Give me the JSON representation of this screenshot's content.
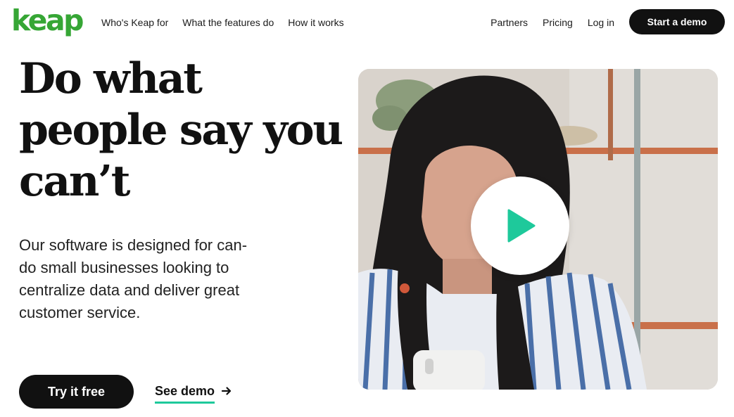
{
  "brand": {
    "logo_text": "keap",
    "accent_color": "#36a635",
    "cta_underline_color": "#1ec99b",
    "play_color": "#1ec99b"
  },
  "nav": {
    "left": [
      "Who's Keap for",
      "What the features do",
      "How it works"
    ],
    "right": [
      "Partners",
      "Pricing",
      "Log in"
    ],
    "cta": "Start a demo"
  },
  "hero": {
    "title": "Do what people say you can’t",
    "body": "Our software is designed for can-do small businesses looking to centralize data and deliver great customer service.",
    "primary_cta": "Try it free",
    "secondary_cta": "See demo"
  },
  "video": {
    "icon": "play-icon"
  }
}
